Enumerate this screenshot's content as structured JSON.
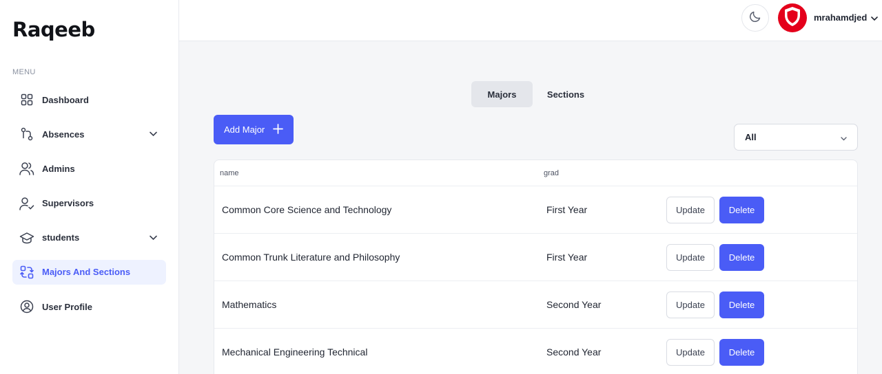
{
  "app": {
    "logo": "Raqeeb"
  },
  "sidebar": {
    "menu_label": "MENU",
    "items": [
      {
        "label": "Dashboard",
        "icon": "dashboard-icon"
      },
      {
        "label": "Absences",
        "icon": "route-icon",
        "has_chevron": true
      },
      {
        "label": "Admins",
        "icon": "users-icon"
      },
      {
        "label": "Supervisors",
        "icon": "user-check-icon"
      },
      {
        "label": "students",
        "icon": "graduation-cap-icon",
        "has_chevron": true
      },
      {
        "label": "Majors And Sections",
        "icon": "arrows-swap-icon",
        "active": true
      },
      {
        "label": "User Profile",
        "icon": "user-circle-icon"
      }
    ]
  },
  "header": {
    "username": "mrahamdjed",
    "theme_toggle_icon": "moon-icon",
    "avatar_icon": "shield-icon"
  },
  "tabs": [
    {
      "label": "Majors",
      "active": true
    },
    {
      "label": "Sections",
      "active": false
    }
  ],
  "toolbar": {
    "add_label": "Add Major",
    "filter_value": "All"
  },
  "table": {
    "columns": [
      "name",
      "grad"
    ],
    "update_label": "Update",
    "delete_label": "Delete",
    "rows": [
      {
        "name": "Common Core Science and Technology",
        "grad": "First Year"
      },
      {
        "name": "Common Trunk Literature and Philosophy",
        "grad": "First Year"
      },
      {
        "name": "Mathematics",
        "grad": "Second Year"
      },
      {
        "name": "Mechanical Engineering Technical",
        "grad": "Second Year"
      }
    ]
  },
  "colors": {
    "accent": "#4a5cf6",
    "active_nav_bg": "#eef2ff",
    "avatar_red": "#e4001b"
  }
}
